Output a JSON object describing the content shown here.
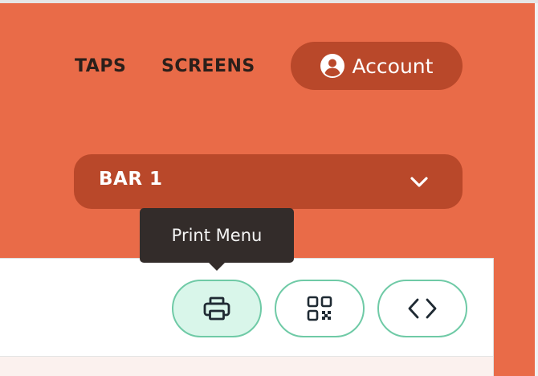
{
  "nav": {
    "taps_label": "TAPS",
    "screens_label": "SCREENS",
    "account_label": "Account",
    "account_icon": "user-circle-icon"
  },
  "bar_select": {
    "selected": "BAR 1",
    "icon": "chevron-down-icon"
  },
  "toolbar": {
    "tooltip_text": "Print Menu",
    "buttons": [
      {
        "name": "print-button",
        "icon": "printer-icon",
        "active": true
      },
      {
        "name": "qr-code-button",
        "icon": "qr-code-icon",
        "active": false
      },
      {
        "name": "embed-code-button",
        "icon": "code-icon",
        "active": false
      }
    ]
  },
  "colors": {
    "header_bg": "#e96b48",
    "pill_bg": "#b9482a",
    "button_border": "#6fcaa6",
    "button_active_bg": "#d9f6ea",
    "tooltip_bg": "#332c2a"
  }
}
